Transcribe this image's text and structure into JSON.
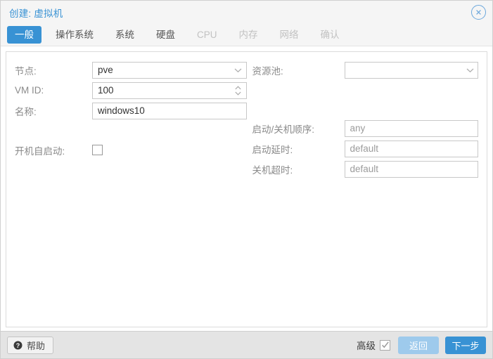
{
  "window": {
    "title": "创建: 虚拟机",
    "close_icon": "close-circle-icon"
  },
  "tabs": [
    {
      "label": "一般",
      "state": "active"
    },
    {
      "label": "操作系统",
      "state": "enabled"
    },
    {
      "label": "系统",
      "state": "enabled"
    },
    {
      "label": "硬盘",
      "state": "enabled"
    },
    {
      "label": "CPU",
      "state": "disabled"
    },
    {
      "label": "内存",
      "state": "disabled"
    },
    {
      "label": "网络",
      "state": "disabled"
    },
    {
      "label": "确认",
      "state": "disabled"
    }
  ],
  "form": {
    "left": {
      "node": {
        "label": "节点:",
        "value": "pve",
        "icon": "chevron-down-icon"
      },
      "vmid": {
        "label": "VM ID:",
        "value": "100",
        "icon": "spinner-updown-icon"
      },
      "name": {
        "label": "名称:",
        "value": "windows10"
      },
      "onboot": {
        "label": "开机自启动:",
        "checked": false
      }
    },
    "right": {
      "pool": {
        "label": "资源池:",
        "value": "",
        "icon": "chevron-down-icon"
      },
      "order": {
        "label": "启动/关机顺序:",
        "value": "any"
      },
      "startup": {
        "label": "启动延时:",
        "value": "default"
      },
      "shutdown": {
        "label": "关机超时:",
        "value": "default"
      }
    }
  },
  "footer": {
    "help": {
      "label": "帮助",
      "icon": "help-circle-icon"
    },
    "advanced": {
      "label": "高级",
      "checked": true,
      "icon": "check-icon"
    },
    "back": {
      "label": "返回"
    },
    "next": {
      "label": "下一步"
    }
  },
  "colors": {
    "accent": "#3892d4",
    "accent_muted": "#9ecaec",
    "title_text": "#3892d4",
    "label_text": "#8a8a8a",
    "footer_bg": "#e4e4e4"
  }
}
